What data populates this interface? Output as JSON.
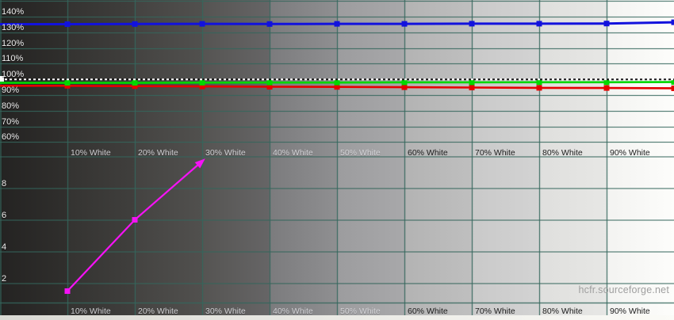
{
  "watermark": "hcfr.sourceforge.net",
  "colors": {
    "grid": "rgba(52,102,92,0.8)",
    "reference_white": "#ffffff",
    "reference_black": "#1a1a1a",
    "blue_series": "#1212dd",
    "green_series": "#00d800",
    "red_series": "#e60000",
    "magenta_series": "#f512f5"
  },
  "chart_data": {
    "type": "line",
    "x_unit": "% White",
    "columns": [
      {
        "pct": 10,
        "label": "10% White",
        "tone": "light"
      },
      {
        "pct": 20,
        "label": "20% White",
        "tone": "light"
      },
      {
        "pct": 30,
        "label": "30% White",
        "tone": "light"
      },
      {
        "pct": 40,
        "label": "40% White",
        "tone": "light"
      },
      {
        "pct": 50,
        "label": "50% White",
        "tone": "light"
      },
      {
        "pct": 60,
        "label": "60% White",
        "tone": "dark"
      },
      {
        "pct": 70,
        "label": "70% White",
        "tone": "dark"
      },
      {
        "pct": 80,
        "label": "80% White",
        "tone": "dark"
      },
      {
        "pct": 90,
        "label": "90% White",
        "tone": "dark"
      }
    ],
    "upper_axis": {
      "ticks": [
        "140%",
        "130%",
        "120%",
        "110%",
        "100%",
        "90%",
        "80%",
        "70%",
        "60%"
      ],
      "min": 60,
      "max": 150,
      "grid": true
    },
    "lower_axis": {
      "ticks": [
        "8",
        "6",
        "4",
        "2"
      ],
      "min": 0,
      "max": 10,
      "grid": true
    },
    "reference_line": {
      "axis": "upper",
      "value": 100,
      "style": "black-white-dashed"
    },
    "series": [
      {
        "id": "red",
        "axis": "upper",
        "color": "#e60000",
        "x": [
          0,
          10,
          20,
          30,
          40,
          50,
          60,
          70,
          80,
          90,
          100
        ],
        "values": [
          95.9,
          95.9,
          95.7,
          95.5,
          95.3,
          95.2,
          95.0,
          94.8,
          94.6,
          94.5,
          94.3
        ]
      },
      {
        "id": "green",
        "axis": "upper",
        "color": "#00d800",
        "x": [
          0,
          10,
          20,
          30,
          40,
          50,
          60,
          70,
          80,
          90,
          100
        ],
        "values": [
          97.8,
          97.8,
          97.8,
          97.9,
          98.0,
          98.0,
          98.1,
          98.1,
          98.2,
          98.2,
          98.3
        ]
      },
      {
        "id": "blue",
        "axis": "upper",
        "color": "#1212dd",
        "x": [
          0,
          10,
          20,
          30,
          40,
          50,
          60,
          70,
          80,
          90,
          100
        ],
        "values": [
          135.2,
          135.2,
          135.3,
          135.4,
          135.3,
          135.4,
          135.4,
          135.5,
          135.5,
          135.6,
          136.4
        ]
      },
      {
        "id": "magenta",
        "axis": "lower",
        "color": "#f512f5",
        "arrow_end": true,
        "x": [
          10,
          20,
          30
        ],
        "values": [
          1.5,
          6.0,
          9.7
        ]
      }
    ]
  }
}
